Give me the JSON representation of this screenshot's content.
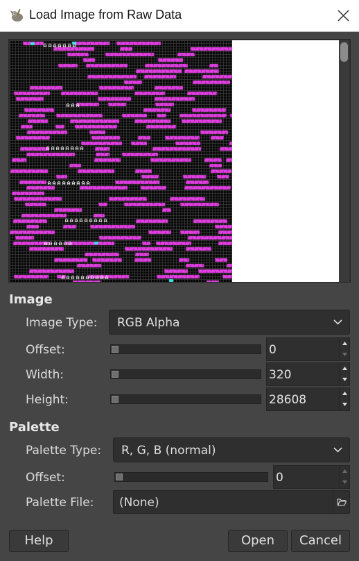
{
  "window": {
    "title": "Load Image from Raw Data"
  },
  "image_section": {
    "title": "Image",
    "image_type": {
      "label": "Image Type:",
      "value": "RGB Alpha"
    },
    "offset": {
      "label": "Offset:",
      "value": "0"
    },
    "width": {
      "label": "Width:",
      "value": "320"
    },
    "height": {
      "label": "Height:",
      "value": "28608"
    }
  },
  "palette_section": {
    "title": "Palette",
    "palette_type": {
      "label": "Palette Type:",
      "value": "R, G, B (normal)"
    },
    "offset": {
      "label": "Offset:",
      "value": "0"
    },
    "palette_file": {
      "label": "Palette File:",
      "value": "(None)"
    }
  },
  "buttons": {
    "help": "Help",
    "open": "Open",
    "cancel": "Cancel"
  },
  "colors": {
    "dialog_bg": "#454545",
    "preview_bg": "#000000",
    "brick": "#e040e0",
    "brick_dark": "#9a1f9a",
    "grid": "#3a3a3a",
    "accent_cyan": "#40e0e0"
  },
  "icons": {
    "app": "gimp-wilber-icon",
    "close": "close-icon",
    "dropdown": "chevron-down-icon",
    "spin_up": "spin-up-icon",
    "spin_down": "spin-down-icon",
    "file_open": "folder-open-icon"
  }
}
